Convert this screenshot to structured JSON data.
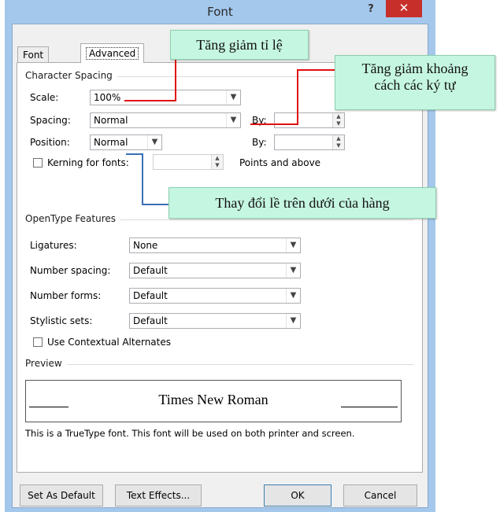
{
  "window": {
    "title": "Font",
    "help_label": "?",
    "close_label": "✕"
  },
  "tabs": [
    {
      "label": "Font"
    },
    {
      "label": "Advanced"
    }
  ],
  "character_spacing": {
    "heading": "Character Spacing",
    "scale": {
      "label": "Scale:",
      "value": "100%"
    },
    "spacing": {
      "label": "Spacing:",
      "value": "Normal",
      "by_label": "By:",
      "by_value": ""
    },
    "position": {
      "label": "Position:",
      "value": "Normal",
      "by_label": "By:",
      "by_value": ""
    },
    "kerning": {
      "label": "Kerning for fonts:",
      "value": "",
      "suffix": "Points and above",
      "checked": false
    }
  },
  "opentype": {
    "heading": "OpenType Features",
    "ligatures": {
      "label": "Ligatures:",
      "value": "None"
    },
    "number_spacing": {
      "label": "Number spacing:",
      "value": "Default"
    },
    "number_forms": {
      "label": "Number forms:",
      "value": "Default"
    },
    "stylistic_sets": {
      "label": "Stylistic sets:",
      "value": "Default"
    },
    "contextual": {
      "label": "Use Contextual Alternates",
      "checked": false
    }
  },
  "preview": {
    "heading": "Preview",
    "sample": "Times New Roman",
    "note": "This is a TrueType font. This font will be used on both printer and screen."
  },
  "buttons": {
    "set_default": "Set As Default",
    "text_effects": "Text Effects...",
    "ok": "OK",
    "cancel": "Cancel"
  },
  "annotations": {
    "scale_callout": "Tăng giảm tỉ lệ",
    "spacing_callout_line1": "Tăng giảm khoảng",
    "spacing_callout_line2": "cách các ký tự",
    "position_callout": "Thay đổi lề trên dưới của hàng"
  },
  "colors": {
    "callout_bg": "#c5f6e1",
    "pointer_red": "#e01010",
    "pointer_blue": "#3a6fb5",
    "close_button": "#c7302a",
    "title_bar": "#a4c8ec"
  },
  "icons": {
    "dropdown": "chevron-down-icon",
    "spin": "spin-arrows-icon",
    "close": "close-icon",
    "help": "help-icon"
  }
}
